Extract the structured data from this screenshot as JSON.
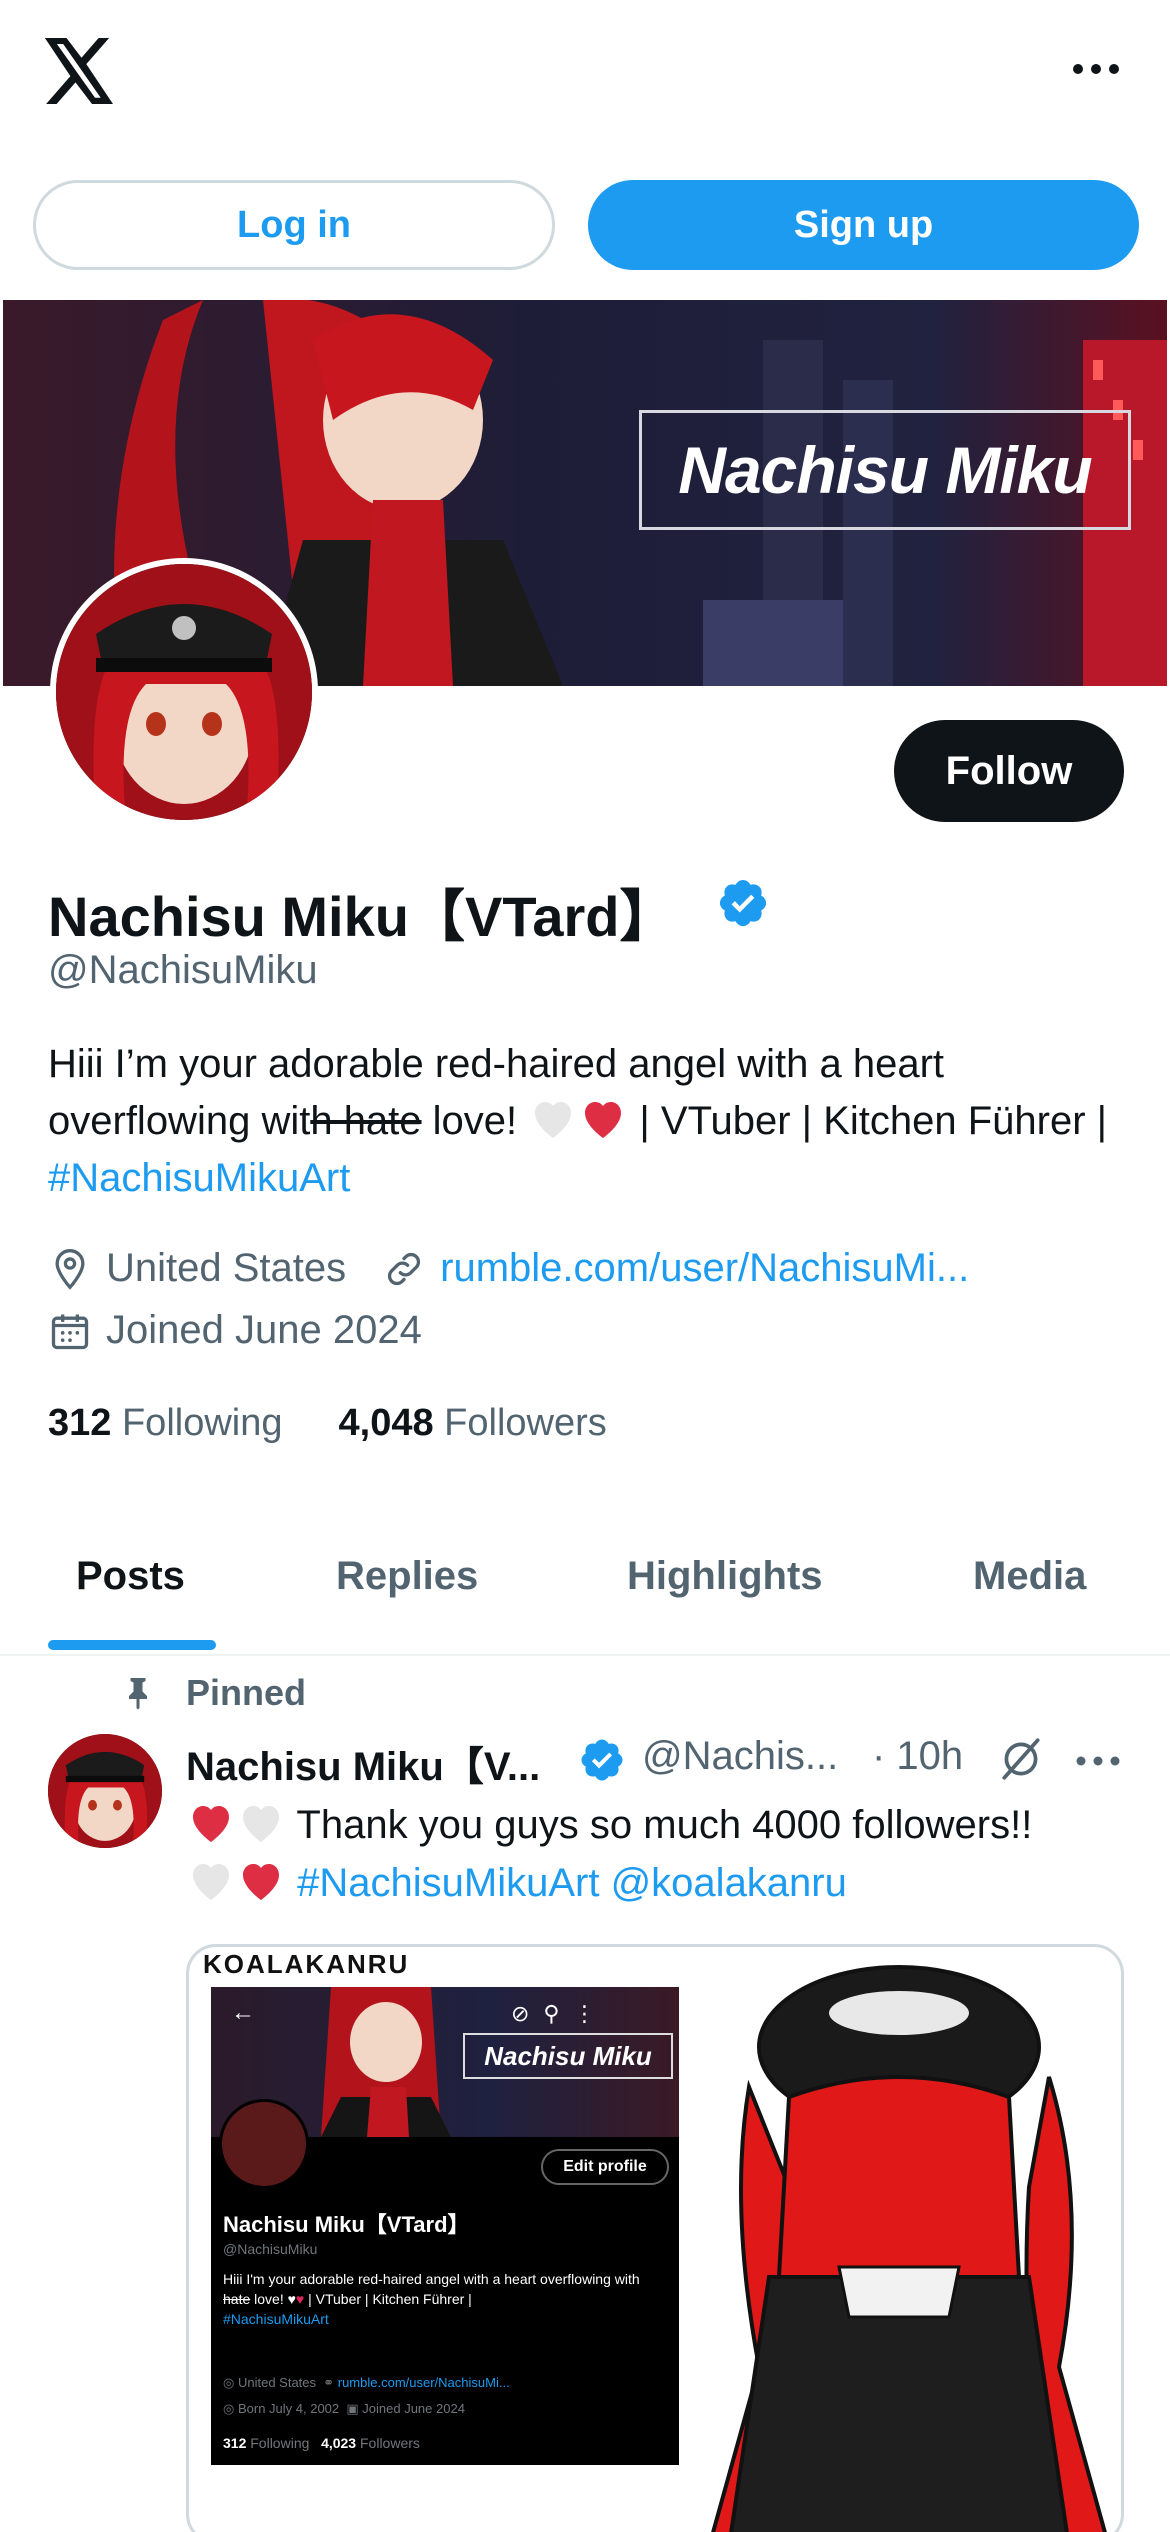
{
  "header": {
    "logo_icon": "x-logo-icon",
    "more_icon": "more-horizontal-icon"
  },
  "auth": {
    "login_label": "Log in",
    "signup_label": "Sign up"
  },
  "banner": {
    "title": "Nachisu Miku"
  },
  "profile": {
    "display_name": "Nachisu Miku【VTard】",
    "handle": "@NachisuMiku",
    "follow_label": "Follow",
    "bio_part1": "Hiii I’m your adorable red-haired angel with a heart overflowing wit",
    "bio_strike": "h hate",
    "bio_part2": " love! ",
    "bio_part3": " | VTuber | Kitchen Führer | ",
    "bio_hashtag": "#NachisuMikuArt",
    "location": "United States",
    "website": "rumble.com/user/NachisuMi...",
    "joined": "Joined June 2024",
    "following_count": "312",
    "following_label": "Following",
    "followers_count": "4,048",
    "followers_label": "Followers"
  },
  "tabs": [
    {
      "label": "Posts",
      "active": true
    },
    {
      "label": "Replies",
      "active": false
    },
    {
      "label": "Highlights",
      "active": false
    },
    {
      "label": "Media",
      "active": false
    }
  ],
  "post": {
    "pinned_label": "Pinned",
    "author_name": "Nachisu Miku【V...",
    "author_handle": "@Nachis...",
    "time": "· 10h",
    "text_main": " Thank you guys so much 4000 followers!!",
    "hashtag": "#NachisuMikuArt",
    "mention": "@koalakanru",
    "media": {
      "caption": "KOALAKANRU",
      "inner_banner_title": "Nachisu Miku",
      "inner_edit_label": "Edit profile",
      "inner_name": "Nachisu Miku【VTard】",
      "inner_handle": "@NachisuMiku",
      "inner_bio_1": "Hiii I'm your adorable red-haired angel with a heart overflowing with",
      "inner_bio_strike": " hate",
      "inner_bio_2": " love! ",
      "inner_bio_3": " | VTuber | Kitchen Führer |",
      "inner_bio_tag": "#NachisuMikuArt",
      "inner_location": "United States",
      "inner_website": "rumble.com/user/NachisuMi...",
      "inner_born": "Born July 4, 2002",
      "inner_joined": "Joined June 2024",
      "inner_following_count": "312",
      "inner_following_label": "Following",
      "inner_followers_count": "4,023",
      "inner_followers_label": "Followers"
    }
  },
  "colors": {
    "accent": "#1d9bf0",
    "text": "#0f1419",
    "secondary": "#536471",
    "heart_red": "#e0245e"
  }
}
